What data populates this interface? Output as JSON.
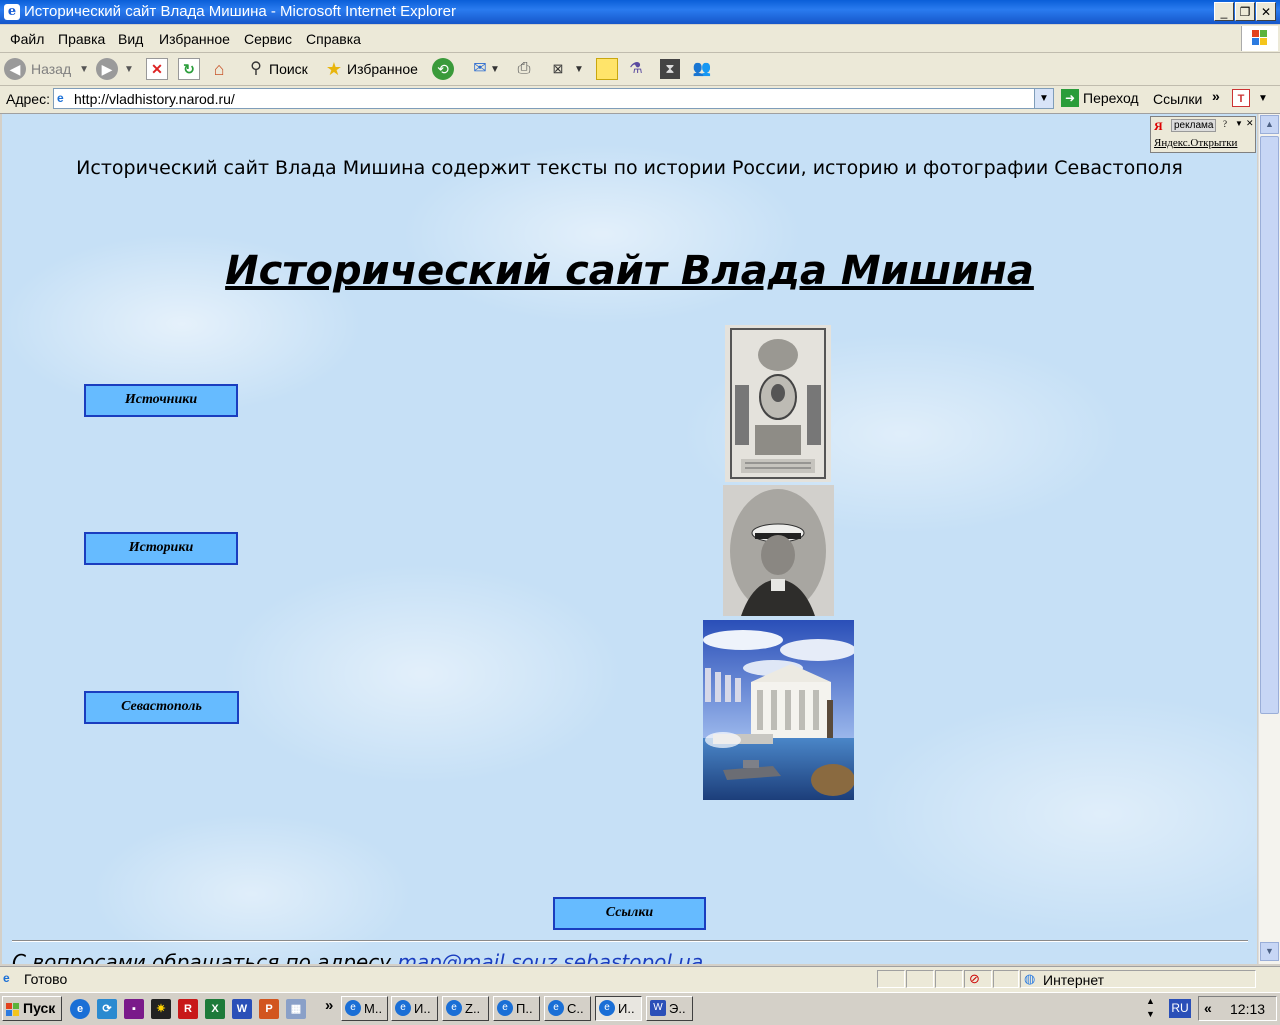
{
  "window": {
    "title": "Исторический сайт Влада Мишина - Microsoft Internet Explorer",
    "minimize": "_",
    "maximize": "❐",
    "close": "✕"
  },
  "menu": [
    "Файл",
    "Правка",
    "Вид",
    "Избранное",
    "Сервис",
    "Справка"
  ],
  "toolbar": {
    "back": "Назад",
    "search": "Поиск",
    "favorites": "Избранное"
  },
  "address": {
    "label": "Адрес:",
    "url": "http://vladhistory.narod.ru/",
    "go": "Переход",
    "links": "Ссылки"
  },
  "page": {
    "tagline": "Исторический сайт Влада Мишина содержит тексты по истории России, историю и фотографии Севастополя",
    "title": "Исторический сайт Влада Мишина",
    "nav": {
      "sources": "Источники",
      "historians": "Историки",
      "sevastopol": "Севастополь",
      "links": "Ссылки"
    },
    "contact_text": "С вопросами обращаться по адресу",
    "contact_email": "map@mail.souz.sebastopol.ua"
  },
  "yandex": {
    "logo": "Я",
    "ad_label": "реклама",
    "link": "Яндекс.Открытки"
  },
  "status": {
    "text": "Готово",
    "zone": "Интернет"
  },
  "taskbar": {
    "start": "Пуск",
    "chevron": "»",
    "tasks": [
      "М..",
      "И..",
      "Z..",
      "П..",
      "С..",
      "И..",
      "Э.."
    ],
    "lang": "RU",
    "tray_chevron": "«",
    "time": "12:13"
  },
  "colors": {
    "nav_button_fill": "#66bbff",
    "nav_button_border": "#1a3dbf",
    "page_background": "#c6e0f6",
    "link": "#1a3dbf"
  }
}
